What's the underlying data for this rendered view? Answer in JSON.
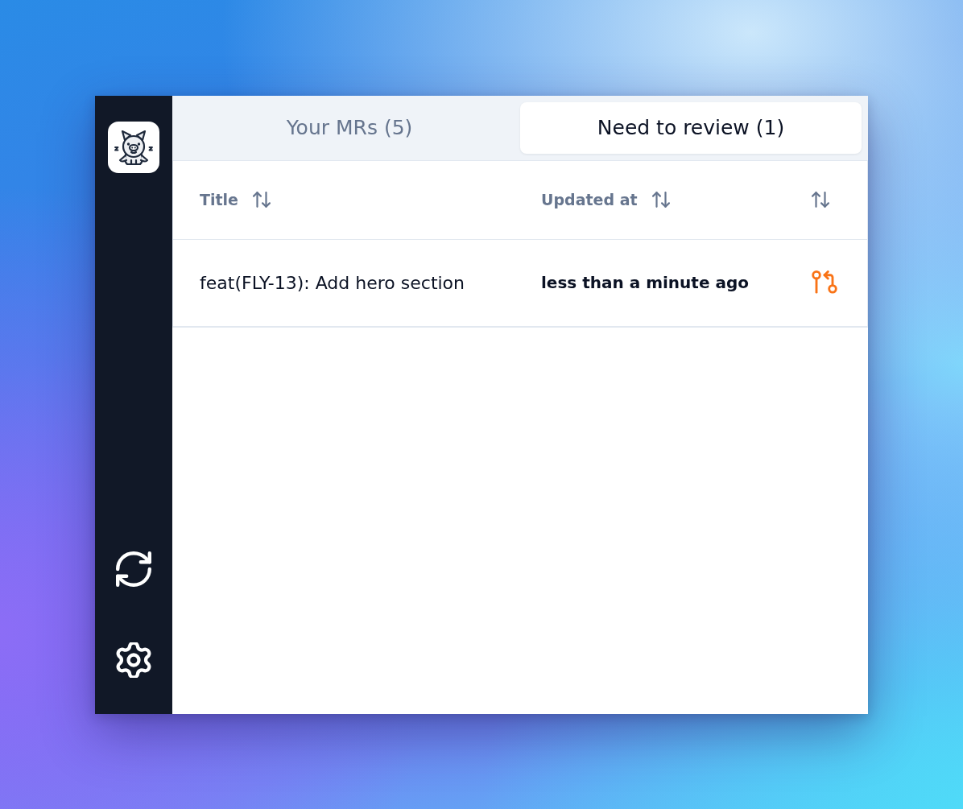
{
  "tabs": [
    {
      "label": "Your MRs (5)",
      "selected": false
    },
    {
      "label": "Need to review (1)",
      "selected": true
    }
  ],
  "table": {
    "columns": [
      {
        "label": "Title",
        "sortable": true
      },
      {
        "label": "Updated at",
        "sortable": true
      },
      {
        "sortable": true
      }
    ],
    "rows": [
      {
        "title": "feat(FLY-13): Add hero section",
        "updated_at": "less than a minute ago"
      }
    ]
  }
}
